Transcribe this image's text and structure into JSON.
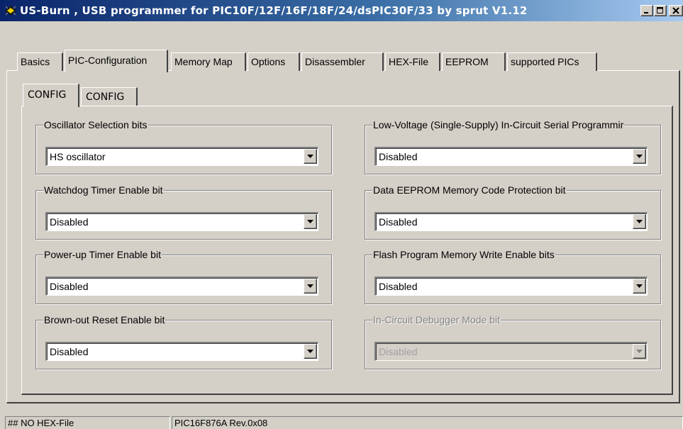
{
  "window": {
    "title": "US-Burn , USB programmer for PIC10F/12F/16F/18F/24/dsPIC30F/33  by sprut V1.12",
    "controls": [
      "minimize",
      "maximize",
      "close"
    ]
  },
  "tabs": [
    {
      "label": "Basics",
      "active": false
    },
    {
      "label": "PIC-Configuration",
      "active": true
    },
    {
      "label": "Memory Map",
      "active": false
    },
    {
      "label": "Options",
      "active": false
    },
    {
      "label": "Disassembler",
      "active": false
    },
    {
      "label": "HEX-File",
      "active": false
    },
    {
      "label": "EEPROM",
      "active": false
    },
    {
      "label": "supported PICs",
      "active": false
    }
  ],
  "subtabs": [
    {
      "label": "CONFIG",
      "active": true
    },
    {
      "label": "CONFIG",
      "active": false
    }
  ],
  "config": {
    "left": [
      {
        "label": "Oscillator Selection bits",
        "value": "HS oscillator",
        "enabled": true
      },
      {
        "label": "Watchdog Timer Enable bit",
        "value": "Disabled",
        "enabled": true
      },
      {
        "label": "Power-up Timer Enable bit",
        "value": "Disabled",
        "enabled": true
      },
      {
        "label": "Brown-out Reset Enable bit",
        "value": "Disabled",
        "enabled": true
      }
    ],
    "right": [
      {
        "label": "Low-Voltage (Single-Supply) In-Circuit Serial Programmir",
        "value": "Disabled",
        "enabled": true
      },
      {
        "label": "Data EEPROM Memory Code Protection bit",
        "value": "Disabled",
        "enabled": true
      },
      {
        "label": "Flash Program Memory Write Enable bits",
        "value": "Disabled",
        "enabled": true
      },
      {
        "label": "In-Circuit Debugger Mode bit",
        "value": "Disabled",
        "enabled": false
      }
    ]
  },
  "status": {
    "file": "## NO HEX-File",
    "device": "PIC16F876A   Rev.0x08"
  },
  "colors": {
    "face": "#d4d0c8",
    "title_start": "#0a246a",
    "title_end": "#a6caf0",
    "disabled_text": "#808080"
  }
}
